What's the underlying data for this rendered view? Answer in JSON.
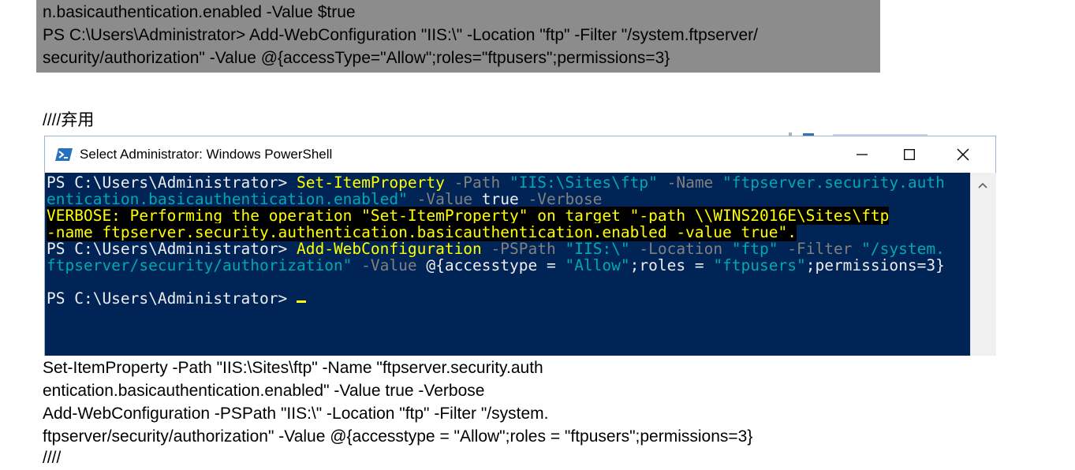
{
  "doc_block": {
    "lines": [
      "n.basicauthentication.enabled -Value $true",
      "PS C:\\Users\\Administrator> Add-WebConfiguration \"IIS:\\\" -Location \"ftp\" -Filter \"/system.ftpserver/",
      "security/authorization\" -Value @{accessType=\"Allow\";roles=\"ftpusers\";permissions=3}"
    ]
  },
  "heading": "////弃用",
  "window": {
    "title": "Select Administrator: Windows PowerShell",
    "icons": {
      "app": "powershell-icon",
      "minimize": "minimize-icon",
      "maximize": "maximize-icon",
      "close": "close-icon",
      "scroll_up": "chevron-up-icon"
    },
    "colors": {
      "console_bg": "#012456",
      "command": "#ffff00",
      "parameter": "#808080",
      "string": "#00a8b3",
      "text": "#eeedf0",
      "verbose_bg": "#000000"
    },
    "console": {
      "line1": {
        "prompt": "PS C:\\Users\\Administrator> ",
        "cmd": "Set-ItemProperty",
        "p1": " -Path ",
        "s1": "\"IIS:\\Sites\\ftp\"",
        "p2": " -Name ",
        "s2": "\"ftpserver.security.auth"
      },
      "line2": {
        "s1": "entication.basicauthentication.enabled\"",
        "p1": " -Value ",
        "v1": "true",
        "p2": " -Verbose"
      },
      "verbose_line1": "VERBOSE: Performing the operation \"Set-ItemProperty\" on target \"-path \\\\WINS2016E\\Sites\\ftp",
      "verbose_line2": "-name ftpserver.security.authentication.basicauthentication.enabled -value true\".",
      "line5": {
        "prompt": "PS C:\\Users\\Administrator> ",
        "cmd": "Add-WebConfiguration",
        "p1": " -PSPath ",
        "s1": "\"IIS:\\\"",
        "p2": " -Location ",
        "s2": "\"ftp\"",
        "p3": " -Filter ",
        "s3": "\"/system."
      },
      "line6": {
        "s1": "ftpserver/security/authorization\"",
        "p1": " -Value ",
        "t1": "@{accesstype = ",
        "s2": "\"Allow\"",
        "t2": ";roles = ",
        "s3": "\"ftpusers\"",
        "t3": ";permissions=3}"
      },
      "line8_prompt": "PS C:\\Users\\Administrator> "
    }
  },
  "bottom_lines": [
    "Set-ItemProperty -Path \"IIS:\\Sites\\ftp\" -Name \"ftpserver.security.auth",
    "entication.basicauthentication.enabled\" -Value true -Verbose",
    "Add-WebConfiguration -PSPath \"IIS:\\\" -Location \"ftp\" -Filter \"/system.",
    "ftpserver/security/authorization\" -Value @{accesstype = \"Allow\";roles = \"ftpusers\";permissions=3}",
    "////"
  ]
}
